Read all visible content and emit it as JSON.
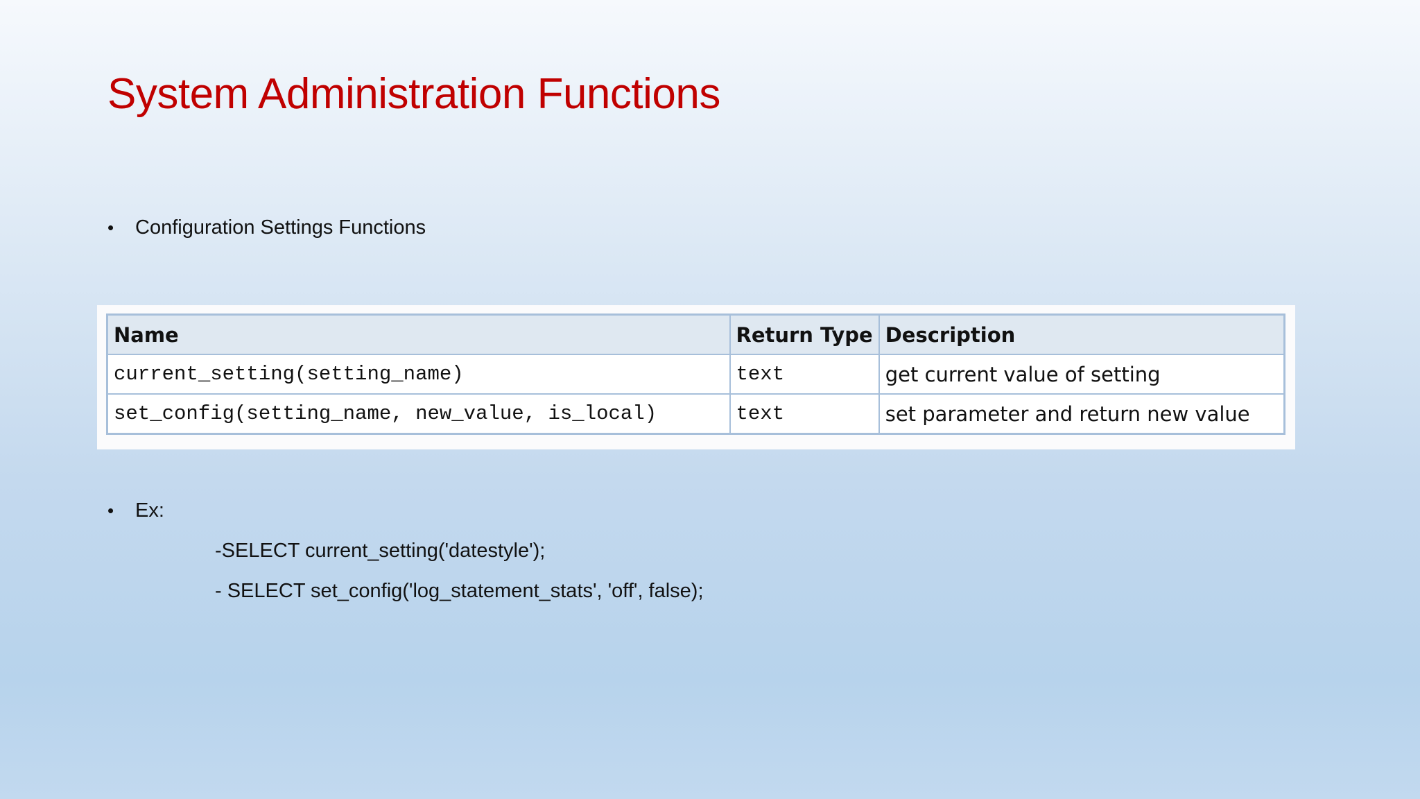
{
  "slide": {
    "title": "System Administration Functions",
    "bullets": [
      "Configuration Settings Functions",
      "Ex:"
    ],
    "bullet_symbol": "•",
    "examples": [
      "-SELECT current_setting('datestyle');",
      "- SELECT set_config('log_statement_stats', 'off', false);"
    ]
  },
  "table": {
    "headers": [
      "Name",
      "Return Type",
      "Description"
    ],
    "rows": [
      [
        "current_setting(setting_name)",
        "text",
        "get current value of setting"
      ],
      [
        "set_config(setting_name, new_value, is_local)",
        "text",
        "set parameter and return new value"
      ]
    ]
  },
  "colors": {
    "title": "#c00000",
    "table_border": "#a7bfda",
    "header_bg": "#dfe8f1"
  }
}
